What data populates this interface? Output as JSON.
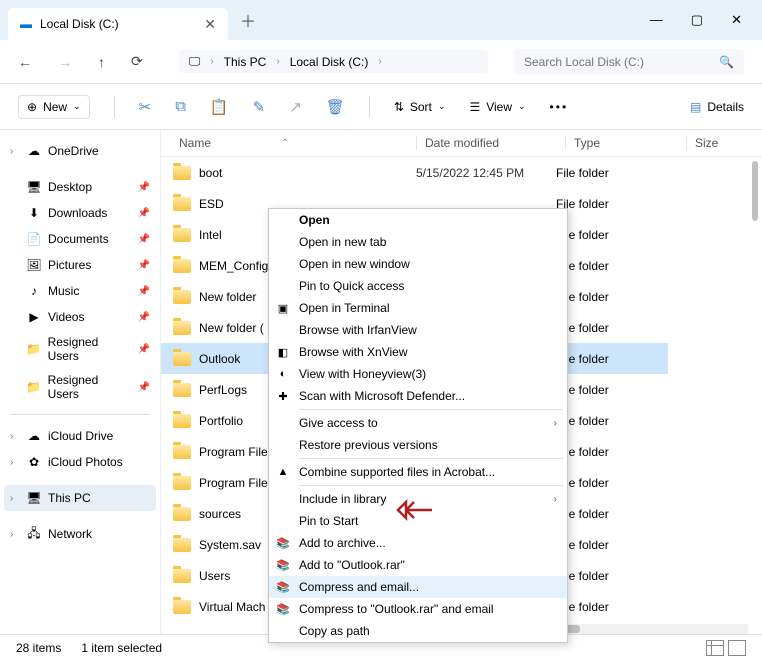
{
  "title": "Local Disk (C:)",
  "window": {
    "min": "—",
    "max": "▢",
    "close": "✕"
  },
  "nav": {
    "breadcrumb": [
      "This PC",
      "Local Disk (C:)"
    ],
    "search_placeholder": "Search Local Disk (C:)"
  },
  "toolbar": {
    "new": "New",
    "sort": "Sort",
    "view": "View",
    "details": "Details"
  },
  "columns": {
    "name": "Name",
    "date": "Date modified",
    "type": "Type",
    "size": "Size"
  },
  "sidebar": [
    {
      "label": "OneDrive",
      "chev": true,
      "icon": "onedrive"
    },
    {
      "spacer": true
    },
    {
      "label": "Desktop",
      "pin": true,
      "icon": "desktop"
    },
    {
      "label": "Downloads",
      "pin": true,
      "icon": "download"
    },
    {
      "label": "Documents",
      "pin": true,
      "icon": "document"
    },
    {
      "label": "Pictures",
      "pin": true,
      "icon": "pictures"
    },
    {
      "label": "Music",
      "pin": true,
      "icon": "music"
    },
    {
      "label": "Videos",
      "pin": true,
      "icon": "videos"
    },
    {
      "label": "Resigned Users",
      "pin": true,
      "icon": "folder"
    },
    {
      "label": "Resigned Users",
      "pin": true,
      "icon": "folder"
    },
    {
      "sep": true
    },
    {
      "label": "iCloud Drive",
      "chev": true,
      "icon": "icloud"
    },
    {
      "label": "iCloud Photos",
      "chev": true,
      "icon": "iphotos"
    },
    {
      "spacer": true
    },
    {
      "label": "This PC",
      "chev": true,
      "icon": "pc",
      "selected": true
    },
    {
      "spacer": true
    },
    {
      "label": "Network",
      "chev": true,
      "icon": "network"
    }
  ],
  "files": [
    {
      "name": "boot",
      "date": "5/15/2022 12:45 PM",
      "type": "File folder"
    },
    {
      "name": "ESD",
      "type": "File folder"
    },
    {
      "name": "Intel",
      "type": "File folder"
    },
    {
      "name": "MEM_Config",
      "type": "File folder"
    },
    {
      "name": "New folder",
      "type": "File folder"
    },
    {
      "name": "New folder (",
      "type": "File folder"
    },
    {
      "name": "Outlook",
      "type": "File folder",
      "selected": true
    },
    {
      "name": "PerfLogs",
      "type": "File folder"
    },
    {
      "name": "Portfolio",
      "type": "File folder"
    },
    {
      "name": "Program File",
      "type": "File folder"
    },
    {
      "name": "Program File",
      "type": "File folder"
    },
    {
      "name": "sources",
      "type": "File folder"
    },
    {
      "name": "System.sav",
      "type": "File folder"
    },
    {
      "name": "Users",
      "type": "File folder"
    },
    {
      "name": "Virtual Mach",
      "type": "File folder"
    }
  ],
  "context_menu": [
    {
      "label": "Open",
      "bold": true
    },
    {
      "label": "Open in new tab"
    },
    {
      "label": "Open in new window"
    },
    {
      "label": "Pin to Quick access"
    },
    {
      "label": "Open in Terminal",
      "icon": "terminal"
    },
    {
      "label": "Browse with IrfanView"
    },
    {
      "label": "Browse with XnView",
      "icon": "xnview"
    },
    {
      "label": "View with Honeyview(3)",
      "icon": "honeyview"
    },
    {
      "label": "Scan with Microsoft Defender...",
      "icon": "defender"
    },
    {
      "sep": true
    },
    {
      "label": "Give access to",
      "sub": true
    },
    {
      "label": "Restore previous versions"
    },
    {
      "sep": true
    },
    {
      "label": "Combine supported files in Acrobat...",
      "icon": "acrobat"
    },
    {
      "sep": true
    },
    {
      "label": "Include in library",
      "sub": true
    },
    {
      "label": "Pin to Start"
    },
    {
      "label": "Add to archive...",
      "icon": "rar"
    },
    {
      "label": "Add to \"Outlook.rar\"",
      "icon": "rar"
    },
    {
      "label": "Compress and email...",
      "icon": "rar",
      "hover": true
    },
    {
      "label": "Compress to \"Outlook.rar\" and email",
      "icon": "rar"
    },
    {
      "label": "Copy as path"
    }
  ],
  "status": {
    "items": "28 items",
    "selected": "1 item selected"
  }
}
